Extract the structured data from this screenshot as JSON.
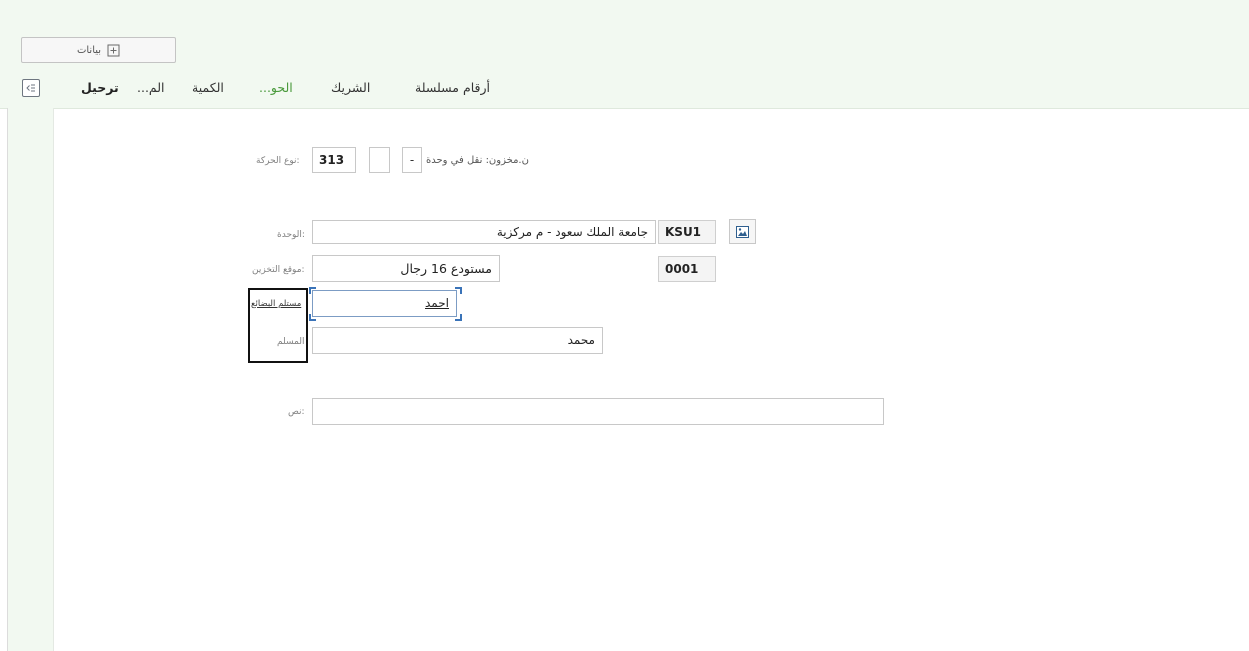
{
  "toolbar": {
    "details_label": "بيانات",
    "details_icon": "add-box-icon"
  },
  "tabs": [
    {
      "label": "أرقام مسلسلة",
      "active": false
    },
    {
      "label": "الشريك",
      "active": false
    },
    {
      "label": "...الحو",
      "active": true
    },
    {
      "label": "الكمية",
      "active": false
    },
    {
      "label": "...الم",
      "active": false
    },
    {
      "label": "ترحيل",
      "active": false
    }
  ],
  "colors": {
    "accent": "#4a9a3c",
    "band_background": "#f2f9f1",
    "focus_corner": "#3a73b8"
  },
  "form": {
    "movement_type": {
      "label": ":نوع الحركة",
      "code": "313",
      "sign": "-",
      "description": "ن.مخزون: نقل في وحدة"
    },
    "plant": {
      "label": ":الوحدة",
      "value": "جامعة الملك سعود - م مركزية",
      "code": "KSU1"
    },
    "storage_location": {
      "label": ":موقع التخزين",
      "value": "مستودع 16 رجال",
      "code": "0001"
    },
    "goods_recipient": {
      "label": "مستلم البضائع",
      "value": "احمد"
    },
    "unloading_point": {
      "label": "المسلم",
      "value": "محمد"
    },
    "text": {
      "label": ":نص",
      "value": ""
    }
  }
}
